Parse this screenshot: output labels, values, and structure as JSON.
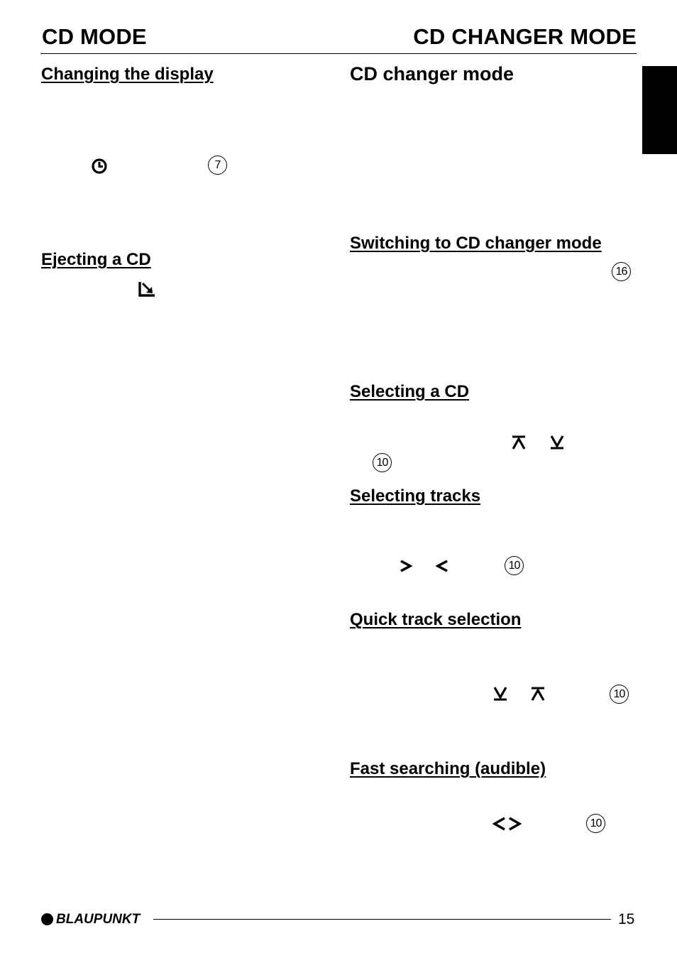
{
  "header": {
    "left_title": "CD MODE",
    "right_title": "CD CHANGER MODE"
  },
  "left_column": {
    "sections": [
      {
        "heading": "Changing the display",
        "icons": [
          {
            "name": "clock-icon",
            "glyph": "◷"
          },
          {
            "name": "button-ref-7",
            "label": "7"
          }
        ]
      },
      {
        "heading": "Ejecting a CD",
        "icons": [
          {
            "name": "eject-icon",
            "glyph": "↘"
          }
        ]
      }
    ]
  },
  "right_column": {
    "title": "CD changer mode",
    "sections": [
      {
        "heading": "Switching to CD changer mode",
        "button_ref": "16"
      },
      {
        "heading": "Selecting a CD",
        "keys": [
          "up-arrow",
          "down-arrow"
        ],
        "button_ref": "10"
      },
      {
        "heading": "Selecting tracks",
        "keys": [
          ">",
          "<"
        ],
        "button_ref": "10"
      },
      {
        "heading": "Quick track selection",
        "keys": [
          "down-arrow",
          "up-arrow"
        ],
        "button_ref": "10"
      },
      {
        "heading": "Fast searching (audible)",
        "keys": "<>",
        "button_ref": "10"
      }
    ]
  },
  "footer": {
    "brand": "BLAUPUNKT",
    "page_number": "15"
  }
}
